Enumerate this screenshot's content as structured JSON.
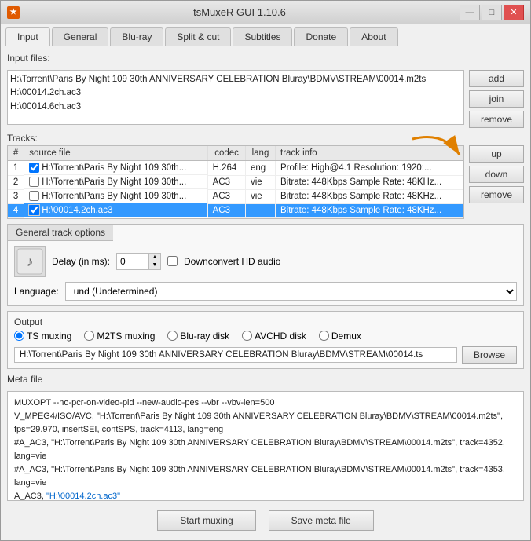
{
  "window": {
    "title": "tsMuxeR GUI 1.10.6",
    "icon": "★"
  },
  "title_buttons": {
    "minimize": "—",
    "maximize": "□",
    "close": "✕"
  },
  "tabs": [
    {
      "label": "Input",
      "active": true
    },
    {
      "label": "General",
      "active": false
    },
    {
      "label": "Blu-ray",
      "active": false
    },
    {
      "label": "Split & cut",
      "active": false
    },
    {
      "label": "Subtitles",
      "active": false
    },
    {
      "label": "Donate",
      "active": false
    },
    {
      "label": "About",
      "active": false
    }
  ],
  "input_files_label": "Input files:",
  "input_files": [
    "H:\\Torrent\\Paris By Night 109  30th ANNIVERSARY CELEBRATION Bluray\\BDMV\\STREAM\\00014.m2ts",
    "H:\\00014.2ch.ac3",
    "H:\\00014.6ch.ac3"
  ],
  "file_buttons": {
    "add": "add",
    "join": "join",
    "remove": "remove"
  },
  "tracks_label": "Tracks:",
  "tracks_headers": [
    "#",
    "source file",
    "codec",
    "lang",
    "track info"
  ],
  "tracks": [
    {
      "num": "1",
      "checked": true,
      "source": "H:\\Torrent\\Paris By Night 109  30th...",
      "codec": "H.264",
      "lang": "eng",
      "info": "Profile: High@4.1 Resolution: 1920:...",
      "selected": false
    },
    {
      "num": "2",
      "checked": false,
      "source": "H:\\Torrent\\Paris By Night 109  30th...",
      "codec": "AC3",
      "lang": "vie",
      "info": "Bitrate: 448Kbps Sample Rate: 48KHz...",
      "selected": false
    },
    {
      "num": "3",
      "checked": false,
      "source": "H:\\Torrent\\Paris By Night 109  30th...",
      "codec": "AC3",
      "lang": "vie",
      "info": "Bitrate: 448Kbps Sample Rate: 48KHz...",
      "selected": false
    },
    {
      "num": "4",
      "checked": true,
      "source": "H:\\00014.2ch.ac3",
      "codec": "AC3",
      "lang": "",
      "info": "Bitrate: 448Kbps Sample Rate: 48KHz...",
      "selected": true
    }
  ],
  "track_buttons": {
    "up": "up",
    "down": "down",
    "remove": "remove"
  },
  "general_track_options": {
    "tab_label": "General track options",
    "delay_label": "Delay (in ms):",
    "delay_value": "0",
    "downconvert_label": "Downconvert HD audio",
    "language_label": "Language:",
    "language_value": "und (Undetermined)"
  },
  "output": {
    "label": "Output",
    "options": [
      {
        "label": "TS muxing",
        "checked": true
      },
      {
        "label": "M2TS muxing",
        "checked": false
      },
      {
        "label": "Blu-ray disk",
        "checked": false
      },
      {
        "label": "AVCHD disk",
        "checked": false
      },
      {
        "label": "Demux",
        "checked": false
      }
    ],
    "path": "H:\\Torrent\\Paris By Night 109  30th ANNIVERSARY CELEBRATION Bluray\\BDMV\\STREAM\\00014.ts",
    "browse_label": "Browse"
  },
  "meta": {
    "label": "Meta file",
    "content_lines": [
      "MUXOPT --no-pcr-on-video-pid --new-audio-pes --vbr  --vbv-len=500",
      "V_MPEG4/ISO/AVC, \"H:\\Torrent\\Paris By Night 109  30th ANNIVERSARY CELEBRATION Bluray\\BDMV\\STREAM\\00014.m2ts\", fps=29.970, insertSEI, contSPS, track=4113, lang=eng",
      "#A_AC3, \"H:\\Torrent\\Paris By Night 109  30th ANNIVERSARY CELEBRATION Bluray\\BDMV\\STREAM\\00014.m2ts\", track=4352, lang=vie",
      "#A_AC3, \"H:\\Torrent\\Paris By Night 109  30th ANNIVERSARY CELEBRATION Bluray\\BDMV\\STREAM\\00014.m2ts\", track=4353, lang=vie",
      "A_AC3, \"H:\\00014.2ch.ac3\""
    ]
  },
  "bottom_buttons": {
    "start": "Start muxing",
    "save_meta": "Save meta file"
  }
}
